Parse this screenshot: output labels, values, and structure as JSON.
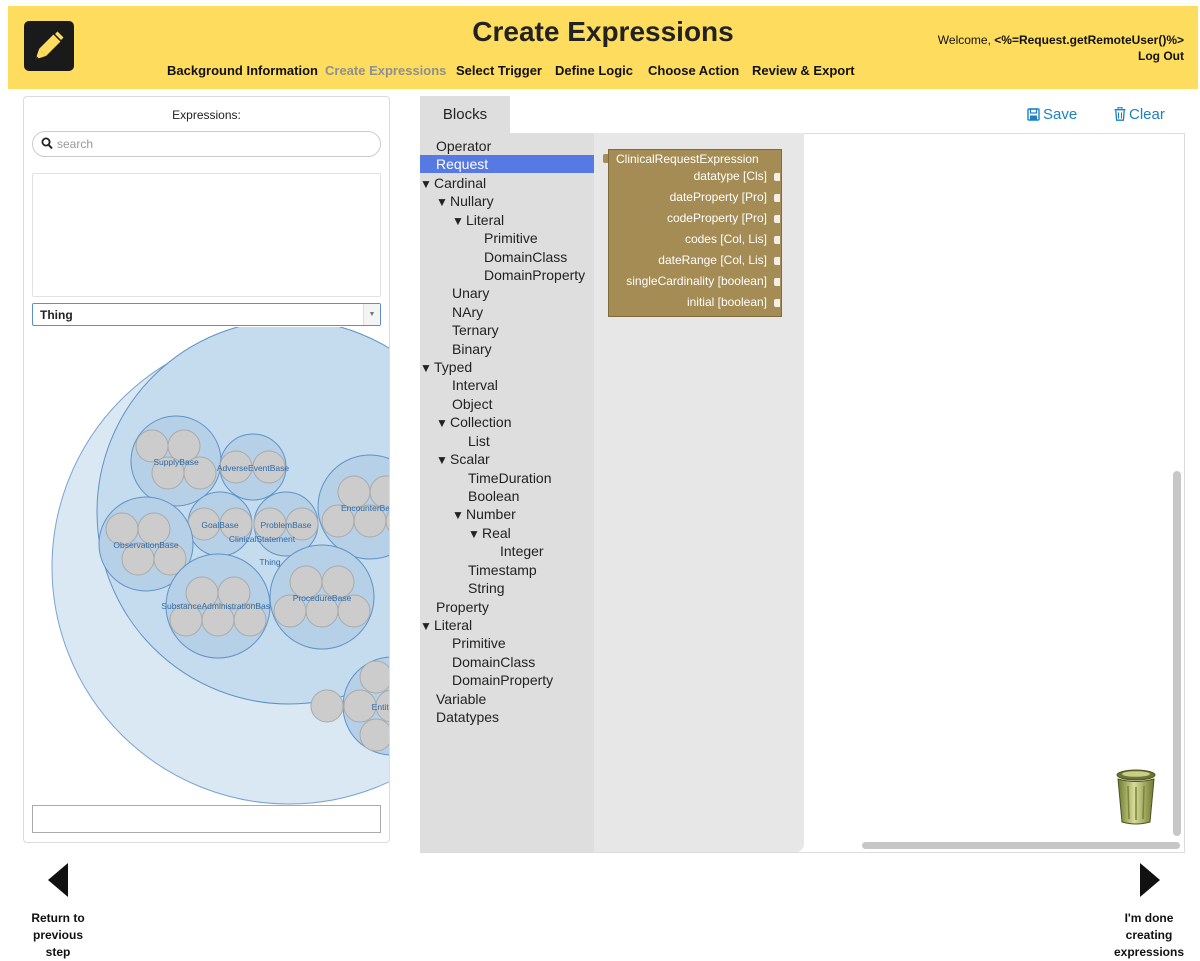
{
  "header": {
    "title": "Create Expressions",
    "logo_icon": "pencil-icon",
    "welcome_prefix": "Welcome,",
    "welcome_user": "<%=Request.getRemoteUser()%>",
    "logout": "Log Out",
    "bg_color": "#fedc5d"
  },
  "nav": {
    "items": [
      {
        "label": "Background Information",
        "active": false
      },
      {
        "label": "Create Expressions",
        "active": true
      },
      {
        "label": "Select Trigger",
        "active": false
      },
      {
        "label": "Define Logic",
        "active": false
      },
      {
        "label": "Choose Action",
        "active": false
      },
      {
        "label": "Review & Export",
        "active": false
      }
    ]
  },
  "left": {
    "label": "Expressions:",
    "search_placeholder": "search",
    "search_icon": "search-icon",
    "select_value": "Thing",
    "bubbles": [
      "SupplyBase",
      "AdverseEventBase",
      "EncounterBase",
      "GoalBase",
      "ProblemBase",
      "ClinicalStatement",
      "ObservationBase",
      "Thing",
      "SubstanceAdministrationBase",
      "ProcedureBase",
      "EntityBase"
    ]
  },
  "workspace": {
    "tab_label": "Blocks",
    "save_label": "Save",
    "clear_label": "Clear",
    "accent": "#1a82c4",
    "tree": [
      {
        "label": "Operator",
        "level": 0,
        "expanded": null,
        "selected": false
      },
      {
        "label": "Request",
        "level": 0,
        "expanded": null,
        "selected": true
      },
      {
        "label": "Cardinal",
        "level": 0,
        "expanded": true,
        "selected": false
      },
      {
        "label": "Nullary",
        "level": 1,
        "expanded": true,
        "selected": false
      },
      {
        "label": "Literal",
        "level": 2,
        "expanded": true,
        "selected": false
      },
      {
        "label": "Primitive",
        "level": 3,
        "expanded": null,
        "selected": false
      },
      {
        "label": "DomainClass",
        "level": 3,
        "expanded": null,
        "selected": false
      },
      {
        "label": "DomainProperty",
        "level": 3,
        "expanded": null,
        "selected": false
      },
      {
        "label": "Unary",
        "level": 1,
        "expanded": null,
        "selected": false
      },
      {
        "label": "NAry",
        "level": 1,
        "expanded": null,
        "selected": false
      },
      {
        "label": "Ternary",
        "level": 1,
        "expanded": null,
        "selected": false
      },
      {
        "label": "Binary",
        "level": 1,
        "expanded": null,
        "selected": false
      },
      {
        "label": "Typed",
        "level": 0,
        "expanded": true,
        "selected": false
      },
      {
        "label": "Interval",
        "level": 1,
        "expanded": null,
        "selected": false
      },
      {
        "label": "Object",
        "level": 1,
        "expanded": null,
        "selected": false
      },
      {
        "label": "Collection",
        "level": 1,
        "expanded": true,
        "selected": false
      },
      {
        "label": "List",
        "level": 2,
        "expanded": null,
        "selected": false
      },
      {
        "label": "Scalar",
        "level": 1,
        "expanded": true,
        "selected": false
      },
      {
        "label": "TimeDuration",
        "level": 2,
        "expanded": null,
        "selected": false
      },
      {
        "label": "Boolean",
        "level": 2,
        "expanded": null,
        "selected": false
      },
      {
        "label": "Number",
        "level": 2,
        "expanded": true,
        "selected": false
      },
      {
        "label": "Real",
        "level": 3,
        "expanded": true,
        "selected": false
      },
      {
        "label": "Integer",
        "level": 4,
        "expanded": null,
        "selected": false
      },
      {
        "label": "Timestamp",
        "level": 2,
        "expanded": null,
        "selected": false
      },
      {
        "label": "String",
        "level": 2,
        "expanded": null,
        "selected": false
      },
      {
        "label": "Property",
        "level": 0,
        "expanded": null,
        "selected": false
      },
      {
        "label": "Literal",
        "level": 0,
        "expanded": true,
        "selected": false
      },
      {
        "label": "Primitive",
        "level": 1,
        "expanded": null,
        "selected": false
      },
      {
        "label": "DomainClass",
        "level": 1,
        "expanded": null,
        "selected": false
      },
      {
        "label": "DomainProperty",
        "level": 1,
        "expanded": null,
        "selected": false
      },
      {
        "label": "Variable",
        "level": 0,
        "expanded": null,
        "selected": false
      },
      {
        "label": "Datatypes",
        "level": 0,
        "expanded": null,
        "selected": false
      }
    ],
    "block": {
      "title": "ClinicalRequestExpression",
      "fields": [
        "datatype [Cls]",
        "dateProperty [Pro]",
        "codeProperty [Pro]",
        "codes [Col, Lis]",
        "dateRange [Col, Lis]",
        "singleCardinality [boolean]",
        "initial [boolean]"
      ],
      "color": "#a58c55"
    }
  },
  "footer": {
    "prev_label": "Return to previous step",
    "next_label": "I'm done creating expressions"
  }
}
